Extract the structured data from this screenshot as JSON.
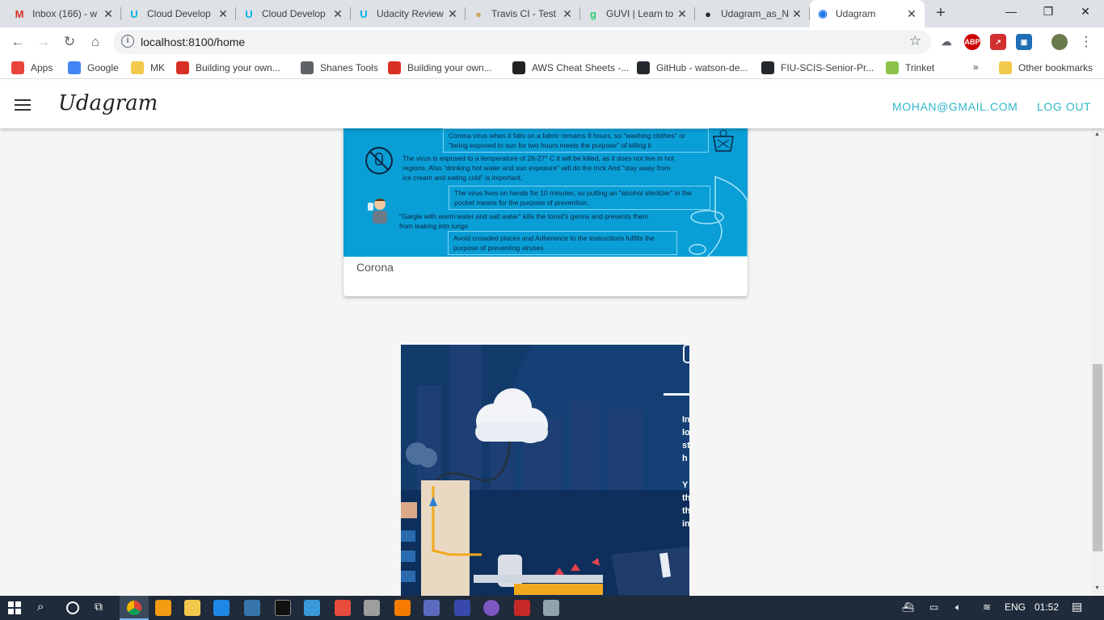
{
  "browser": {
    "tabs": [
      {
        "title": "Inbox (166) - w",
        "icon": "gmail-icon",
        "color": "#d93025",
        "glyph": "M"
      },
      {
        "title": "Cloud Develop",
        "icon": "udacity-icon",
        "color": "#02b3e4",
        "glyph": "U"
      },
      {
        "title": "Cloud Develop",
        "icon": "udacity-icon",
        "color": "#02b3e4",
        "glyph": "U"
      },
      {
        "title": "Udacity Review",
        "icon": "udacity-icon",
        "color": "#02b3e4",
        "glyph": "U"
      },
      {
        "title": "Travis CI - Test",
        "icon": "travis-icon",
        "color": "#c9a86a",
        "glyph": "●"
      },
      {
        "title": "GUVI | Learn to",
        "icon": "guvi-icon",
        "color": "#2ecc71",
        "glyph": "g"
      },
      {
        "title": "Udagram_as_N",
        "icon": "github-icon",
        "color": "#24292e",
        "glyph": "●"
      },
      {
        "title": "Udagram",
        "icon": "chrome-page-icon",
        "color": "#1a73e8",
        "glyph": "◉"
      }
    ],
    "new_tab_glyph": "+",
    "window_controls": {
      "minimize": "—",
      "restore": "❐",
      "close": "✕"
    },
    "url": "localhost:8100/home",
    "bookmarks": [
      {
        "label": "Apps",
        "icon": "apps-grid-icon",
        "color": "#e8453c"
      },
      {
        "label": "Google",
        "icon": "google-icon",
        "color": "#4285f4"
      },
      {
        "label": "MK",
        "icon": "folder-icon",
        "color": "#f2c94c"
      },
      {
        "label": "Building your own...",
        "icon": "bookmark-site-icon",
        "color": "#d93025"
      },
      {
        "label": "Shanes Tools",
        "icon": "globe-icon",
        "color": "#5f6368"
      },
      {
        "label": "Building your own...",
        "icon": "bookmark-site-icon",
        "color": "#d93025"
      },
      {
        "label": "AWS Cheat Sheets -...",
        "icon": "td-icon",
        "color": "#222222"
      },
      {
        "label": "GitHub - watson-de...",
        "icon": "github-icon",
        "color": "#24292e"
      },
      {
        "label": "FIU-SCIS-Senior-Pr...",
        "icon": "github-icon",
        "color": "#24292e"
      },
      {
        "label": "Trinket",
        "icon": "trinket-icon",
        "color": "#8bc34a"
      }
    ],
    "bookmarks_overflow": "»",
    "other_bookmarks": "Other bookmarks"
  },
  "app": {
    "brand": "Udagram",
    "user_email": "MOHAN@GMAIL.COM",
    "logout_label": "LOG OUT",
    "accent": "#2fb7c9"
  },
  "feed": {
    "items": [
      {
        "caption": "Corona",
        "infographic_tips": [
          {
            "text": "Corona virus when it falls on a fabric remains 9 hours, so \"washing clothes\" or \"being exposed to sun for two hours meets the purpose\" of killing it"
          },
          {
            "text": "The virus is exposed to a temperature of 26-27° C it will be killed, as it does not live in hot regions. Also \"drinking hot water and sun exposure\" will do the trick And \"stay away from ice cream and eating cold\" is important."
          },
          {
            "text": "The virus lives on hands for 10 minutes, so putting an \"alcohol sterilizer\" in the pocket means for the purpose of prevention."
          },
          {
            "text": "\"Gargle with warm water and salt water\" kills the tonsil's germs and prevents them from leaking into lungs"
          },
          {
            "text": "Avoid crowded places and Adherence to the instructions fulfills the purpose of preventing viruses"
          }
        ],
        "infographic_color": "#0a9ed6"
      },
      {
        "infographic_text_fragments": [
          "In",
          "lo",
          "st",
          "h",
          "Y",
          "th",
          "th",
          "in"
        ],
        "infographic_color": "#123a6b"
      }
    ]
  },
  "taskbar": {
    "language": "ENG",
    "time": "01:52"
  }
}
